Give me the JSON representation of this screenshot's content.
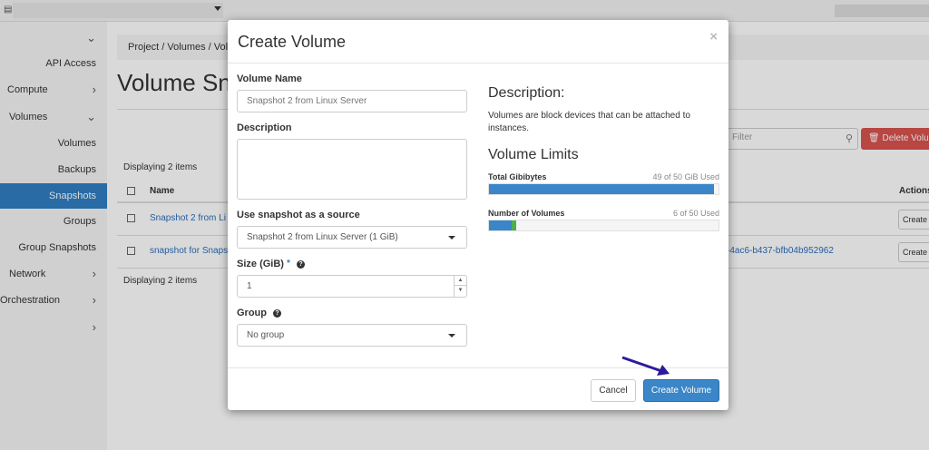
{
  "colors": {
    "accent": "#2f7ec2",
    "primary_button": "#3a86c8",
    "danger": "#d9534f",
    "bar_fill": "#3a86c8",
    "bar_green": "#4cae4c",
    "arrow": "#2a1a9c"
  },
  "topbar": {
    "menu_icon": "grid-icon"
  },
  "sidebar": {
    "items": [
      {
        "label": "API Access"
      },
      {
        "label": "Compute"
      },
      {
        "label": "Volumes"
      },
      {
        "label": "Volumes"
      },
      {
        "label": "Backups"
      },
      {
        "label": "Snapshots"
      },
      {
        "label": "Groups"
      },
      {
        "label": "Group Snapshots"
      },
      {
        "label": "Network"
      },
      {
        "label": "Orchestration"
      }
    ]
  },
  "main": {
    "breadcrumb": "Project /  Volumes /  Vol",
    "title": "Volume Sna",
    "filter_placeholder": "Filter",
    "delete_button": "Delete Volu",
    "displaying_top": "Displaying 2 items",
    "displaying_bottom": "Displaying 2 items",
    "table": {
      "headers": {
        "name": "Name",
        "actions": "Actions"
      },
      "rows": [
        {
          "name": "Snapshot 2 from Li",
          "id": "",
          "action": "Create"
        },
        {
          "name": "snapshot for Snaps",
          "id": "-4ac6-b437-bfb04b952962",
          "action": "Create"
        }
      ]
    }
  },
  "modal": {
    "title": "Create Volume",
    "close": "×",
    "volume_name": {
      "label": "Volume Name",
      "placeholder": "Snapshot 2 from Linux Server"
    },
    "description": {
      "label": "Description",
      "value": ""
    },
    "source": {
      "label": "Use snapshot as a source",
      "selected": "Snapshot 2 from Linux Server (1 GiB)"
    },
    "size": {
      "label": "Size (GiB)",
      "required_mark": "*",
      "value": "1"
    },
    "group": {
      "label": "Group",
      "selected": "No group"
    },
    "info": {
      "heading": "Description:",
      "text": "Volumes are block devices that can be attached to instances."
    },
    "limits": {
      "heading": "Volume Limits",
      "gibibytes": {
        "label": "Total Gibibytes",
        "used_text": "49 of 50 GiB Used",
        "used": 49,
        "max": 50
      },
      "volumes": {
        "label": "Number of Volumes",
        "used_text": "6 of 50 Used",
        "used": 6,
        "max": 50
      }
    },
    "buttons": {
      "cancel": "Cancel",
      "create": "Create Volume"
    }
  }
}
